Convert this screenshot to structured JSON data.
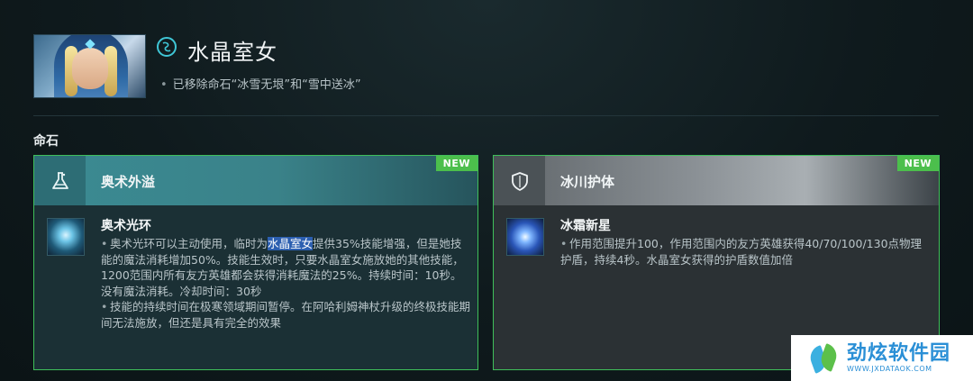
{
  "hero": {
    "name": "水晶室女",
    "note": "已移除命石“冰雪无垠”和“雪中送冰”",
    "bullet": "•"
  },
  "section": {
    "title": "命石"
  },
  "cards": [
    {
      "title": "奥术外溢",
      "badge": "NEW",
      "header_icon": "flask-icon",
      "talent_icon": "arcane-aura-icon",
      "talent_name": "奥术光环",
      "bullets": [
        {
          "before": "奥术光环可以主动使用，临时为",
          "highlight": "水晶室女",
          "after": "提供35%技能增强，但是她技能的魔法消耗增加50%。技能生效时，只要水晶室女施放她的其他技能，1200范围内所有友方英雄都会获得消耗魔法的25%。持续时间：10秒。没有魔法消耗。冷却时间：30秒"
        },
        {
          "text": "技能的持续时间在极寒领域期间暂停。在阿哈利姆神杖升级的终极技能期间无法施放，但还是具有完全的效果"
        }
      ]
    },
    {
      "title": "冰川护体",
      "badge": "NEW",
      "header_icon": "shield-icon",
      "talent_icon": "crystal-nova-icon",
      "talent_name": "冰霜新星",
      "bullets": [
        {
          "text": "作用范围提升100，作用范围内的友方英雄获得40/70/100/130点物理护盾，持续4秒。水晶室女获得的护盾数值加倍"
        }
      ]
    }
  ],
  "watermark": {
    "title": "劲炫软件园",
    "url": "WWW.JXDATAOK.COM"
  },
  "colors": {
    "accent": "#3fc6d6",
    "border_green": "#3fbf5a",
    "badge_green": "#4cbf4c",
    "highlight": "#2c5fb0"
  }
}
